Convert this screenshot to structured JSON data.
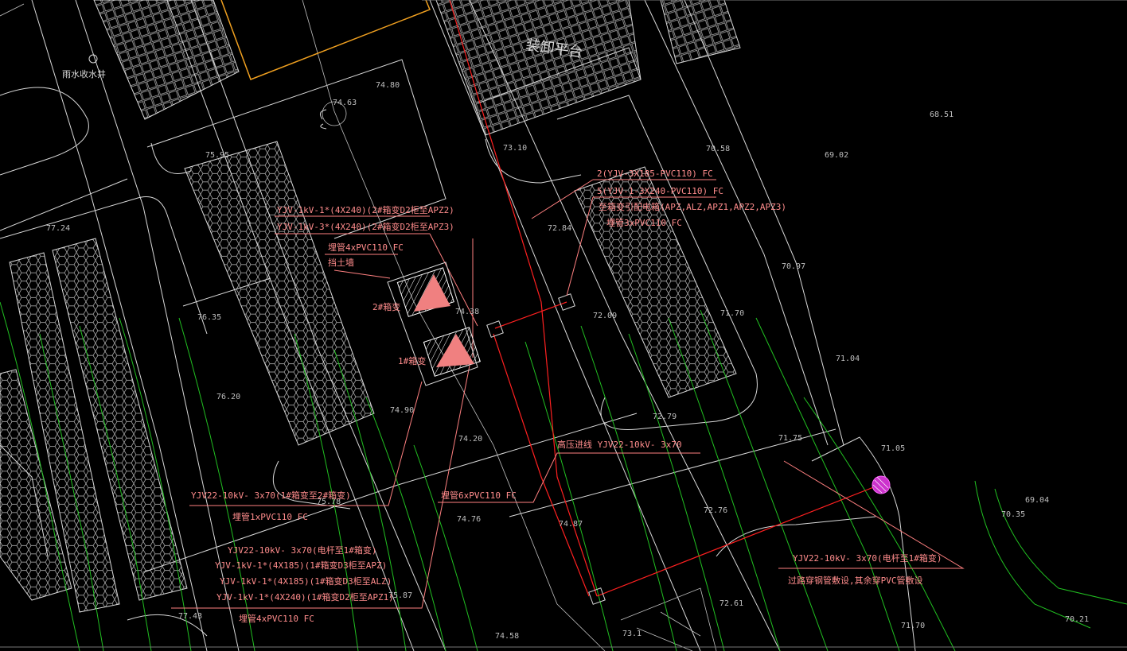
{
  "labels": {
    "platform": "装卸平台",
    "rain_well": "雨水收水井",
    "box2": "2#箱变",
    "box1": "1#箱变",
    "retaining_wall": "挡土墙"
  },
  "elevations": [
    "74.63",
    "74.80",
    "73.10",
    "70.58",
    "69.02",
    "68.51",
    "75.95",
    "77.24",
    "72.84",
    "70.97",
    "76.35",
    "74.38",
    "72.09",
    "71.70",
    "71.04",
    "76.20",
    "74.90",
    "72.79",
    "71.75",
    "71.05",
    "74.20",
    "75.78",
    "72.76",
    "69.04",
    "70.35",
    "74.76",
    "74.87",
    "77.43",
    "75.87",
    "72.61",
    "71.70",
    "70.21",
    "74.58",
    "73.1"
  ],
  "annotations": {
    "a1": "2(YJV-3X185-PVC110) FC",
    "a2": "5(YJV-1-3X240-PVC110) FC",
    "a3": "至箱变引配电箱(APZ,ALZ,APZ1,APZ2,APZ3)",
    "a4": "埋管3xPVC110 FC",
    "a5": "YJV-1kV-1*(4X240)(2#箱变D2柜至APZ2)",
    "a6": "YJV-1kV-3*(4X240)(2#箱变D2柜至APZ3)",
    "a7": "埋管4xPVC110 FC",
    "a8": "高压进线 YJV22-10kV- 3x70",
    "a9": "YJV22-10kV- 3x70(1#箱变至2#箱变)",
    "a10": "埋管1xPVC110 FC",
    "a11": "埋管6xPVC110 FC",
    "a12": "YJV22-10kV- 3x70(电杆至1#箱变)",
    "a13": "YJV-1kV-1*(4X185)(1#箱变D3柜至APZ)",
    "a14": "YJV-1kV-1*(4X185)(1#箱变D3柜至ALZ)",
    "a15": "YJV-1kV-1*(4X240)(1#箱变D2柜至APZ1)",
    "a16": "埋管4xPVC110 FC",
    "a17": "YJV22-10kV- 3x70(电杆至1#箱变)",
    "a18": "过路穿钢管敷设,其余穿PVC管敷设"
  },
  "colors": {
    "cable": "#ff2020",
    "note": "#ff8c8c",
    "contour": "#21c021",
    "outline": "#d9d9d9",
    "boundary": "#f0a020",
    "pole": "#cc33cc"
  }
}
